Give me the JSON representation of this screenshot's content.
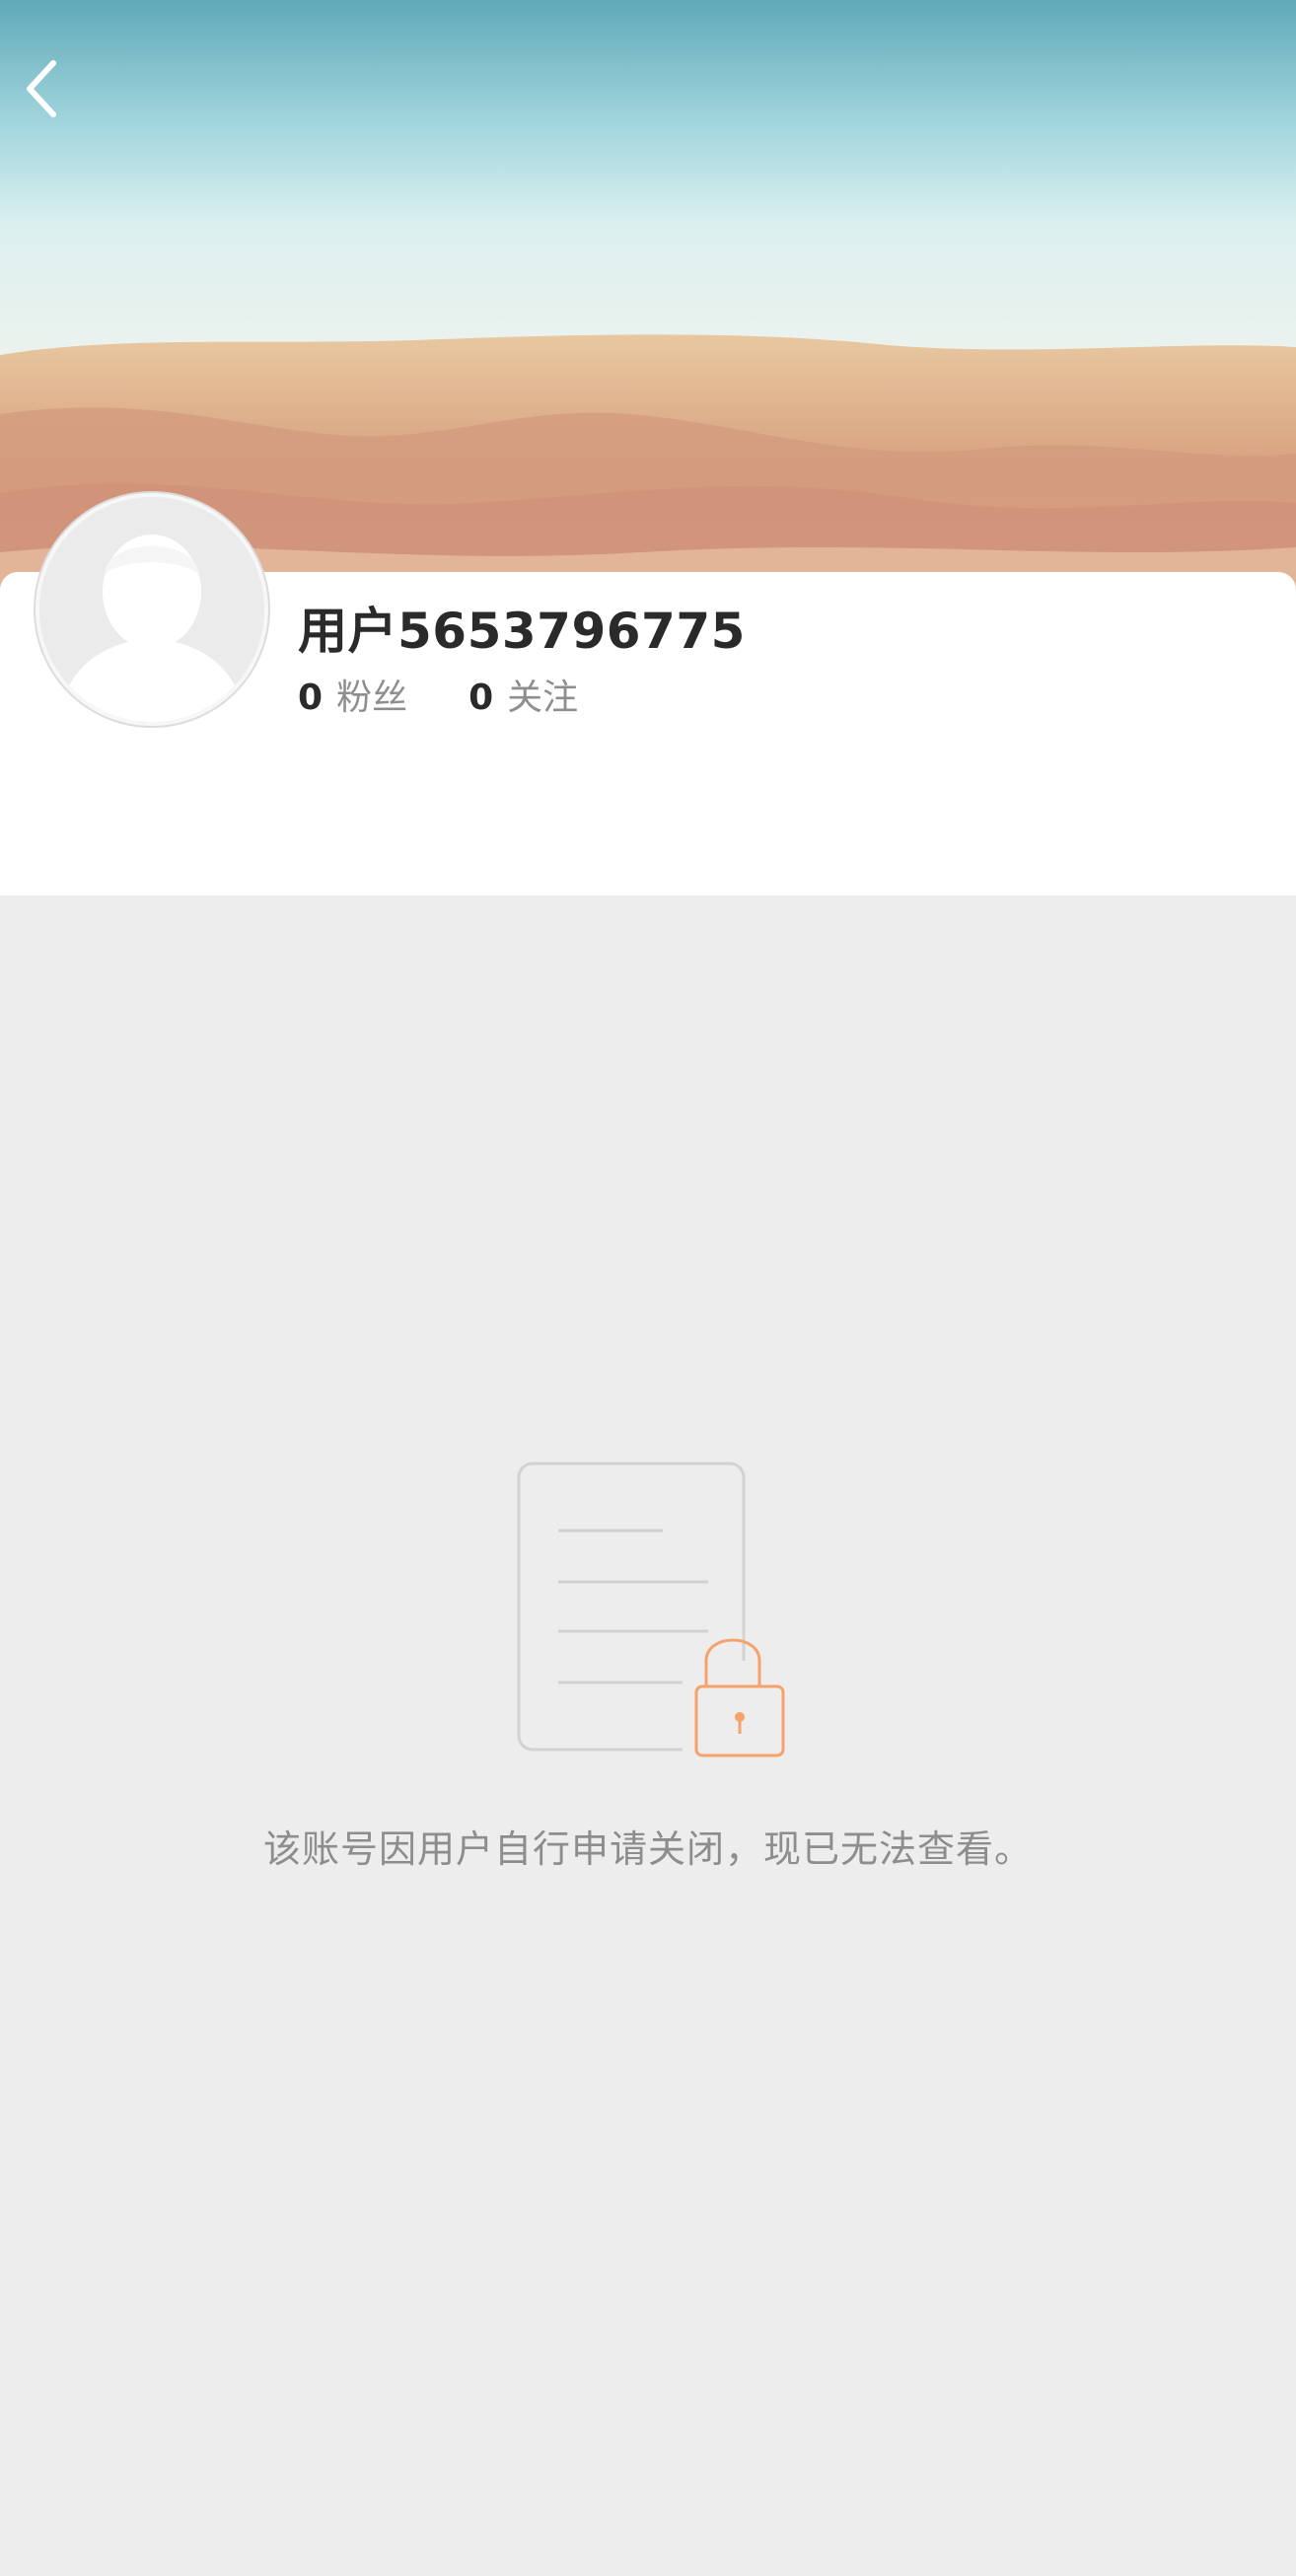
{
  "header": {
    "back_icon": "chevron-left-icon",
    "banner_image": "sandy-beach-cover-photo"
  },
  "profile": {
    "avatar_icon": "default-user-avatar-icon",
    "username": "用户5653796775",
    "followers_count": "0",
    "followers_label": "粉丝",
    "following_count": "0",
    "following_label": "关注"
  },
  "empty_state": {
    "icon": "locked-document-icon",
    "message": "该账号因用户自行申请关闭，现已无法查看。"
  },
  "colors": {
    "background": "#ededed",
    "card": "#ffffff",
    "lock_accent": "#f5a26b",
    "text_primary": "#2a2a2a",
    "text_secondary": "#8d8d8d"
  }
}
